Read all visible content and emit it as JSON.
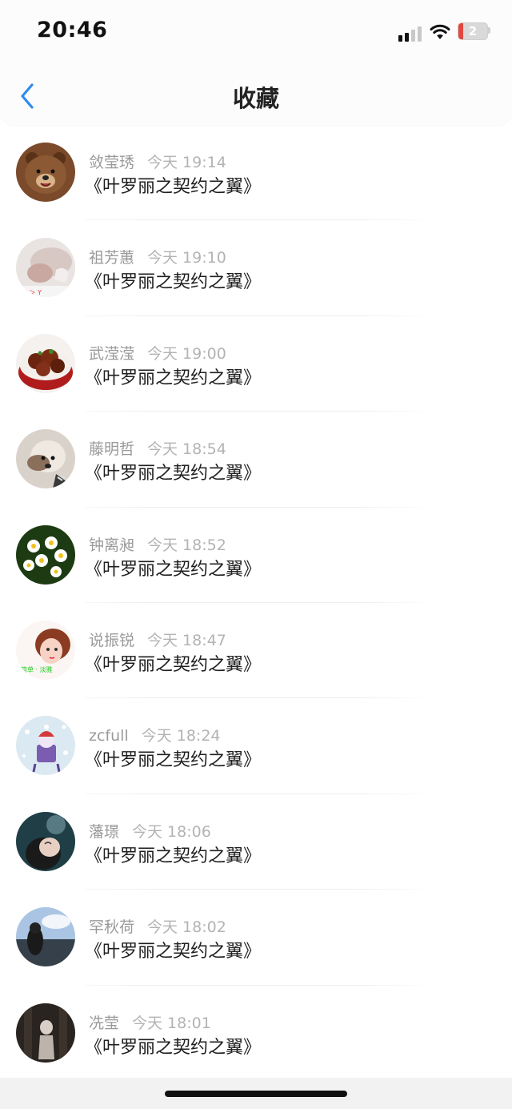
{
  "status_bar": {
    "time": "20:46",
    "battery": "2"
  },
  "nav": {
    "title": "收藏"
  },
  "items": [
    {
      "name": "敛莹琇",
      "time": "今天 19:14",
      "title": "《叶罗丽之契约之翼》"
    },
    {
      "name": "祖芳蕙",
      "time": "今天 19:10",
      "title": "《叶罗丽之契约之翼》"
    },
    {
      "name": "武滢滢",
      "time": "今天 19:00",
      "title": "《叶罗丽之契约之翼》"
    },
    {
      "name": "藤明哲",
      "time": "今天 18:54",
      "title": "《叶罗丽之契约之翼》"
    },
    {
      "name": "钟离昶",
      "time": "今天 18:52",
      "title": "《叶罗丽之契约之翼》"
    },
    {
      "name": "说振锐",
      "time": "今天 18:47",
      "title": "《叶罗丽之契约之翼》"
    },
    {
      "name": "zcfull",
      "time": "今天 18:24",
      "title": "《叶罗丽之契约之翼》"
    },
    {
      "name": "藩璟",
      "time": "今天 18:06",
      "title": "《叶罗丽之契约之翼》"
    },
    {
      "name": "罕秋荷",
      "time": "今天 18:02",
      "title": "《叶罗丽之契约之翼》"
    },
    {
      "name": "冼莹",
      "time": "今天 18:01",
      "title": "《叶罗丽之契约之翼》"
    }
  ],
  "colors": {
    "accent": "#2d8cf0",
    "name_text": "#9a9a9a",
    "time_text": "#b3b3b3",
    "title_text": "#1f1f1f"
  }
}
